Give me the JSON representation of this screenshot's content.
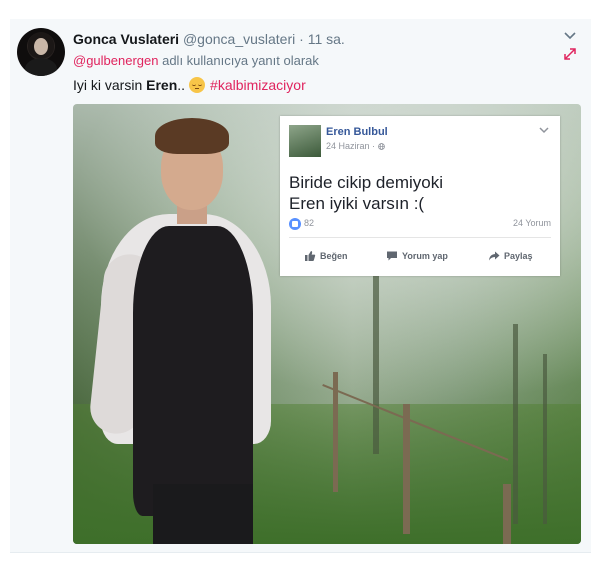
{
  "tweet": {
    "display_name": "Gonca Vuslateri",
    "handle": "@gonca_vuslateri",
    "separator": " · ",
    "time": "11 sa.",
    "reply_to_user": "@gulbenergen",
    "reply_suffix": " adlı kullanıcıya yanıt olarak",
    "text_prefix": "Iyi ki varsin ",
    "text_bold": "Eren",
    "text_after_bold": "..",
    "hashtag": "#kalbimizaciyor",
    "emoji": "relieved-face-emoji"
  },
  "embedded_post": {
    "author": "Eren Bulbul",
    "date": "24 Haziran · ",
    "body_lines": [
      "Biride cikip demiyoki",
      "Eren iyiki varsın :("
    ],
    "like_count": "82",
    "comment_count": "24 Yorum",
    "actions": {
      "like": "Beğen",
      "comment": "Yorum yap",
      "share": "Paylaş"
    }
  },
  "colors": {
    "accent_pink": "#e0245e",
    "text_dark": "#14171a",
    "text_muted": "#657786",
    "fb_blue": "#365899"
  },
  "icons": {
    "caret": "chevron-down-icon",
    "expand": "expand-arrows-icon",
    "globe": "globe-icon",
    "like": "thumbs-up-icon",
    "comment": "comment-icon",
    "share": "share-arrow-icon"
  }
}
